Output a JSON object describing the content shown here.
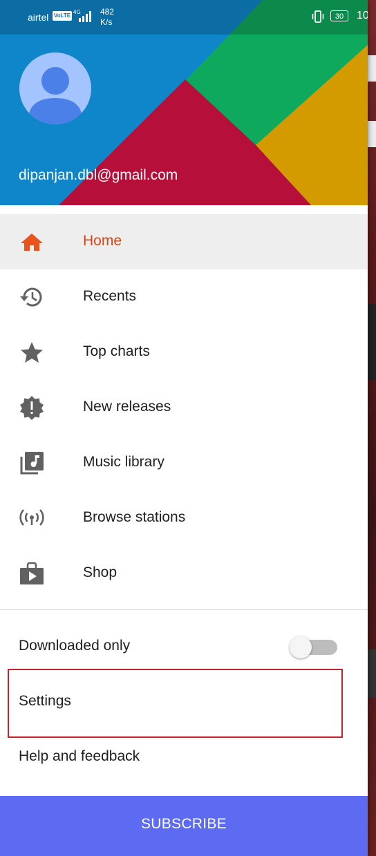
{
  "status_bar": {
    "carrier": "airtel",
    "volte": "VoLTE",
    "network": "4G",
    "speed_value": "482",
    "speed_unit": "K/s",
    "battery": "30",
    "time": "10:"
  },
  "account": {
    "email": "dipanjan.dbl@gmail.com"
  },
  "menu": {
    "items": [
      {
        "label": "Home",
        "icon": "home-icon",
        "active": true
      },
      {
        "label": "Recents",
        "icon": "history-icon"
      },
      {
        "label": "Top charts",
        "icon": "star-icon"
      },
      {
        "label": "New releases",
        "icon": "new-releases-icon"
      },
      {
        "label": "Music library",
        "icon": "music-library-icon"
      },
      {
        "label": "Browse stations",
        "icon": "radio-station-icon"
      },
      {
        "label": "Shop",
        "icon": "shop-icon"
      }
    ]
  },
  "settings": {
    "downloaded_only_label": "Downloaded only",
    "downloaded_only_enabled": false,
    "settings_label": "Settings",
    "help_label": "Help and feedback"
  },
  "subscribe_label": "SUBSCRIBE",
  "colors": {
    "active_item": "#d84315",
    "subscribe_bg": "#5c6bf2",
    "highlight_border": "#c8202a"
  }
}
